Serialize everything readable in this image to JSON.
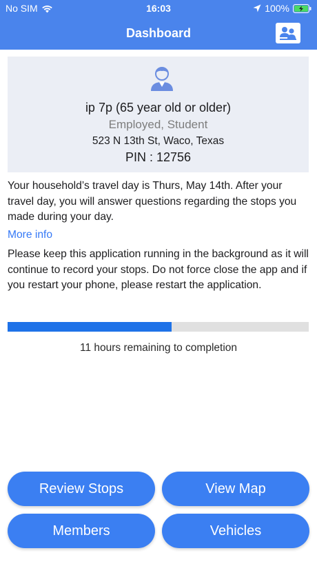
{
  "status_bar": {
    "carrier": "No SIM",
    "time": "16:03",
    "battery": "100%"
  },
  "nav": {
    "title": "Dashboard",
    "right_icon": "household-members-icon"
  },
  "profile": {
    "avatar_icon": "person-icon",
    "name": "ip 7p (65 year old or older)",
    "status": "Employed, Student",
    "address": "523 N 13th St, Waco, Texas",
    "pin": "PIN : 12756"
  },
  "info": {
    "travel_day_text": "Your household’s travel day is Thurs, May 14th. After your travel day, you will answer questions regarding the stops you made during your day.",
    "more_info_link": "More info",
    "keep_running_text": "Please keep this application running in the background as it will continue to record your stops. Do not force close the app and if you restart your phone, please restart the application."
  },
  "progress": {
    "fraction": 0.545,
    "label": "11 hours remaining to completion"
  },
  "buttons": {
    "review_stops": "Review Stops",
    "view_map": "View Map",
    "members": "Members",
    "vehicles": "Vehicles"
  },
  "colors": {
    "header_bg": "#4a84ec",
    "button_bg": "#3b7ff2",
    "progress_fill": "#1e72e8",
    "link": "#3478f6",
    "card_bg": "#ebeef5"
  }
}
